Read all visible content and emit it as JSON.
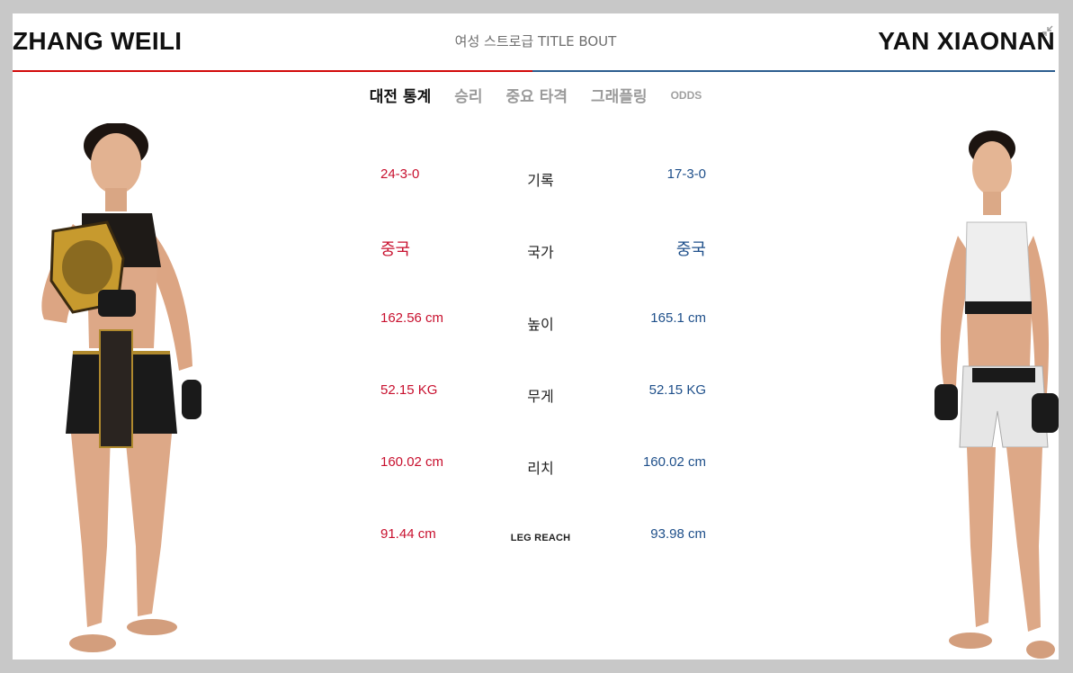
{
  "fighters": {
    "left": {
      "name": "ZHANG WEILI",
      "color": "#c8102e"
    },
    "right": {
      "name": "YAN XIAONAN",
      "color": "#1e4f8a"
    }
  },
  "bout": {
    "title": "여성 스트로급 TITLE BOUT"
  },
  "tabs": [
    {
      "label": "대전 통계",
      "active": true
    },
    {
      "label": "승리",
      "active": false
    },
    {
      "label": "중요 타격",
      "active": false
    },
    {
      "label": "그래플링",
      "active": false
    },
    {
      "label": "ODDS",
      "active": false
    }
  ],
  "stats": [
    {
      "label": "기록",
      "left": "24-3-0",
      "right": "17-3-0"
    },
    {
      "label": "국가",
      "left": "중국",
      "right": "중국"
    },
    {
      "label": "높이",
      "left": "162.56 cm",
      "right": "165.1 cm"
    },
    {
      "label": "무게",
      "left": "52.15 KG",
      "right": "52.15 KG"
    },
    {
      "label": "리치",
      "left": "160.02 cm",
      "right": "160.02 cm"
    },
    {
      "label": "LEG REACH",
      "left": "91.44 cm",
      "right": "93.98 cm"
    }
  ],
  "icons": {
    "collapse": "collapse-arrows-icon"
  },
  "colors": {
    "red": "#d20a0a",
    "blue": "#2c5d8f",
    "background": "#c8c8c8"
  }
}
